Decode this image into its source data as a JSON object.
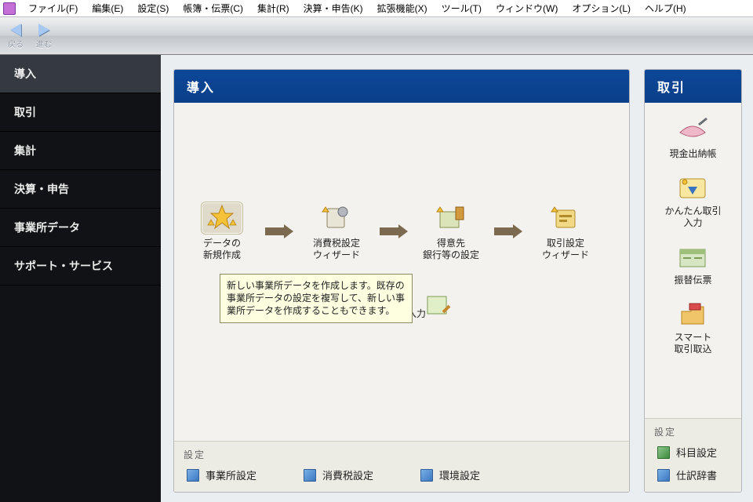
{
  "menubar": {
    "items": [
      "ファイル(F)",
      "編集(E)",
      "設定(S)",
      "帳簿・伝票(C)",
      "集計(R)",
      "決算・申告(K)",
      "拡張機能(X)",
      "ツール(T)",
      "ウィンドウ(W)",
      "オプション(L)",
      "ヘルプ(H)"
    ]
  },
  "toolbar": {
    "back": "戻る",
    "forward": "進む"
  },
  "sidebar": {
    "items": [
      "導入",
      "取引",
      "集計",
      "決算・申告",
      "事業所データ",
      "サポート・サービス"
    ],
    "selected": 0
  },
  "panel_left": {
    "title": "導入",
    "flow1": [
      {
        "line1": "データの",
        "line2": "新規作成"
      },
      {
        "line1": "消費税設定",
        "line2": "ウィザード"
      },
      {
        "line1": "得意先",
        "line2": "銀行等の設定"
      },
      {
        "line1": "取引設定",
        "line2": "ウィザード"
      }
    ],
    "flow2_partial_right": "高入力",
    "tooltip": "新しい事業所データを作成します。既存の事業所データの設定を複写して、新しい事業所データを作成することもできます。",
    "settings_title": "設定",
    "settings": [
      "事業所設定",
      "消費税設定",
      "環境設定"
    ]
  },
  "panel_right": {
    "title": "取引",
    "items": [
      {
        "label1": "現金出納帳",
        "label2": ""
      },
      {
        "label1": "かんたん取引",
        "label2": "入力"
      },
      {
        "label1": "振替伝票",
        "label2": ""
      },
      {
        "label1": "スマート",
        "label2": "取引取込"
      }
    ],
    "settings_title": "設定",
    "settings": [
      "科目設定",
      "仕訳辞書"
    ]
  }
}
